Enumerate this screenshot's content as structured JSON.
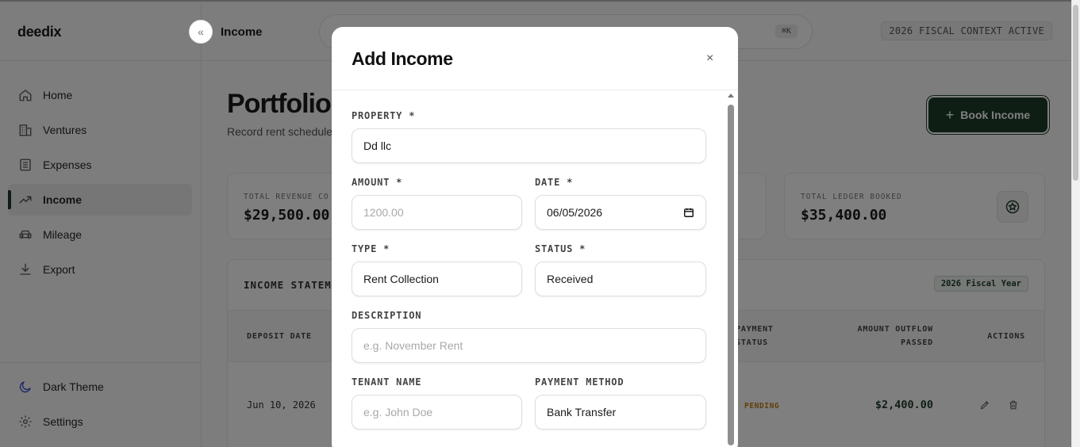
{
  "app": {
    "logo": "deedix"
  },
  "sidebar": {
    "collapse_icon": "«",
    "items": [
      {
        "label": "Home",
        "icon": "home-icon"
      },
      {
        "label": "Ventures",
        "icon": "building-icon"
      },
      {
        "label": "Expenses",
        "icon": "receipt-icon"
      },
      {
        "label": "Income",
        "icon": "trend-up-icon",
        "active": true
      },
      {
        "label": "Mileage",
        "icon": "car-icon"
      },
      {
        "label": "Export",
        "icon": "download-icon"
      }
    ],
    "bottom": [
      {
        "label": "Dark Theme",
        "icon": "moon-icon"
      },
      {
        "label": "Settings",
        "icon": "gear-icon"
      }
    ]
  },
  "topbar": {
    "page": "Income",
    "search_shortcut": "⌘K",
    "fiscal_badge": "2026 FISCAL CONTEXT ACTIVE"
  },
  "main": {
    "title": "Portfolio I",
    "subtitle": "Record rent schedule re",
    "book_button": "Book Income",
    "stats": [
      {
        "label": "TOTAL REVENUE CO",
        "value": "$29,500.00"
      },
      {
        "label": "TOTAL LEDGER BOOKED",
        "value": "$35,400.00"
      }
    ],
    "table": {
      "title": "INCOME STATEME",
      "fiscal_badge": "2026 Fiscal Year",
      "headers": {
        "deposit_date": "DEPOSIT DATE",
        "payment_status": "PAYMENT\nSTATUS",
        "amount": "AMOUNT OUTFLOW\nPASSED",
        "actions": "ACTIONS"
      },
      "rows": [
        {
          "date": "Jun 10, 2026",
          "status": "PENDING",
          "amount": "$2,400.00"
        }
      ]
    }
  },
  "modal": {
    "title": "Add Income",
    "close": "×",
    "fields": {
      "property": {
        "label": "PROPERTY *",
        "value": "Dd llc"
      },
      "amount": {
        "label": "AMOUNT *",
        "placeholder": "1200.00"
      },
      "date": {
        "label": "DATE *",
        "value": "06/05/2026"
      },
      "type": {
        "label": "TYPE *",
        "value": "Rent Collection"
      },
      "status": {
        "label": "STATUS *",
        "value": "Received"
      },
      "description": {
        "label": "DESCRIPTION",
        "placeholder": "e.g. November Rent"
      },
      "tenant": {
        "label": "TENANT NAME",
        "placeholder": "e.g. John Doe"
      },
      "method": {
        "label": "PAYMENT METHOD",
        "value": "Bank Transfer"
      }
    }
  },
  "colors": {
    "brand": "#1e3d2a",
    "pending": "#c47f10",
    "overlay": "rgba(0,0,0,0.5)"
  }
}
